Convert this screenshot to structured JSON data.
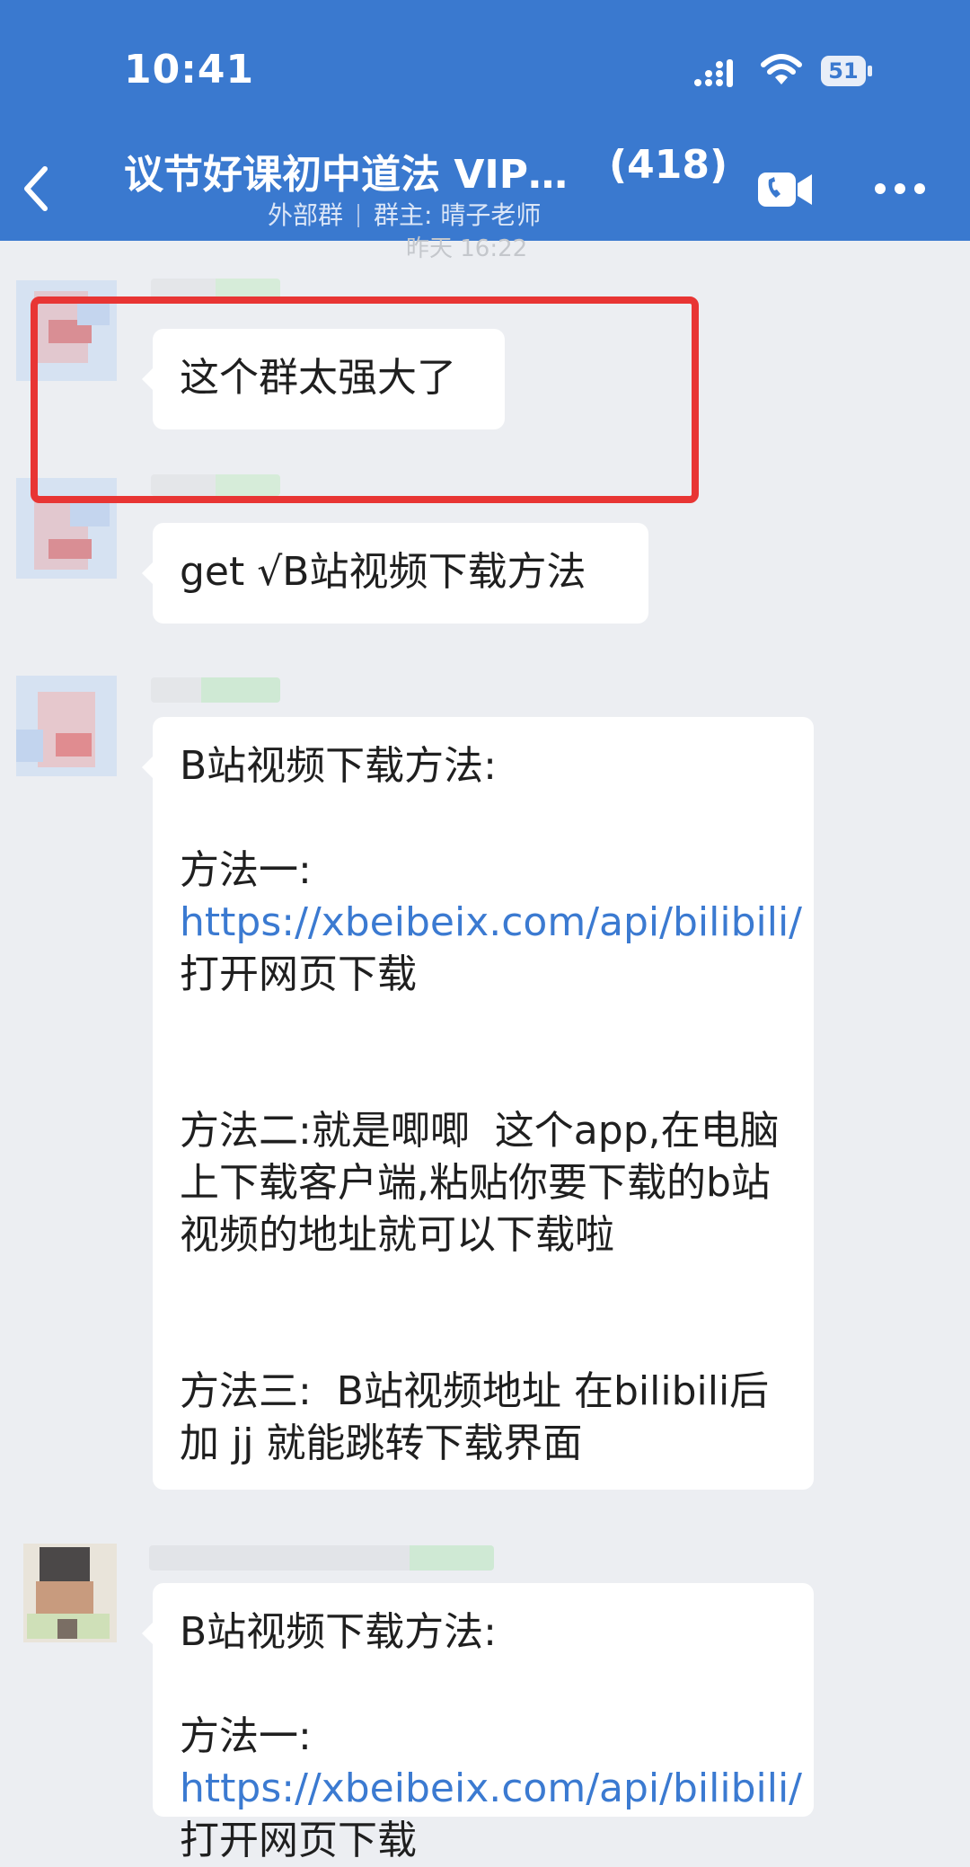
{
  "status_bar": {
    "time": "10:41",
    "battery": "51",
    "icons": [
      "signal-icon",
      "wifi-icon",
      "battery-icon"
    ]
  },
  "header": {
    "title": "议节好课初中道法 VIP…",
    "member_count": "(418)",
    "subtitle_type": "外部群",
    "subtitle_owner": "群主: 晴子老师",
    "icons": [
      "back-arrow-icon",
      "video-call-icon",
      "more-dots-icon"
    ],
    "colors": {
      "bar": "#3a79cf",
      "link": "#3b7ad1",
      "highlight": "#e83534"
    }
  },
  "timestamp": "昨天 16:22",
  "messages": [
    {
      "text": "这个群太强大了"
    },
    {
      "text": "get √B站视频下载方法"
    },
    {
      "paragraphs": [
        {
          "text": "B站视频下载方法:"
        },
        {
          "prefix": "方法一:",
          "link": "https://xbeibeix.com/api/bilibili/",
          "suffix": "打开网页下载"
        },
        {
          "text": "方法二:就是唧唧  这个app,在电脑上下载客户端,粘贴你要下载的b站视频的地址就可以下载啦"
        },
        {
          "text": "方法三:  B站视频地址 在bilibili后加 jj 就能跳转下载界面"
        }
      ]
    },
    {
      "paragraphs": [
        {
          "text": "B站视频下载方法:"
        },
        {
          "prefix": "方法一:",
          "link": "https://xbeibeix.com/api/bilibili/",
          "suffix": "打开网页下载"
        }
      ]
    }
  ]
}
